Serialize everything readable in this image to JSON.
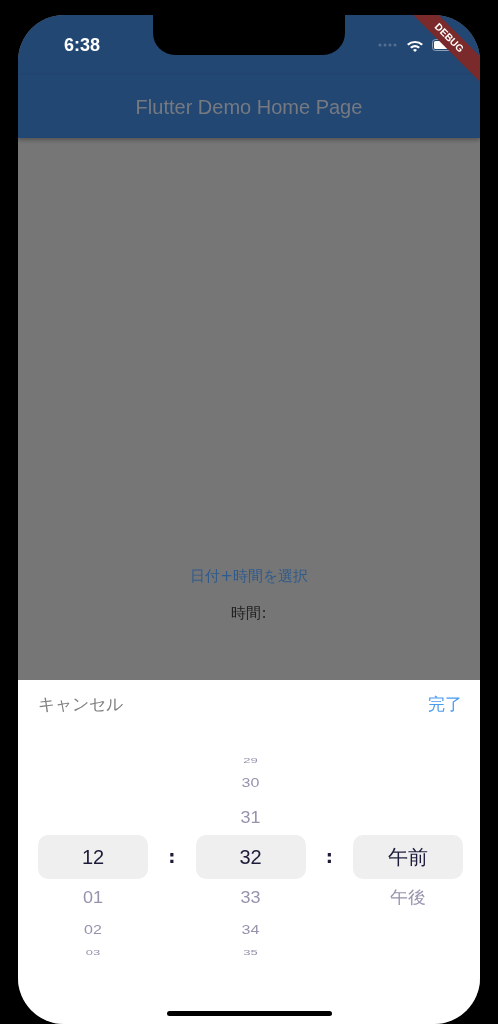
{
  "status_bar": {
    "time": "6:38"
  },
  "debug_banner": {
    "label": "DEBUG"
  },
  "app_bar": {
    "title": "Flutter Demo Home Page"
  },
  "body": {
    "link": "日付+時間を選択",
    "time_label": "時間:"
  },
  "picker": {
    "cancel": "キャンセル",
    "done": "完了",
    "columns": [
      {
        "items": [
          {
            "label": "12",
            "selected": true
          },
          {
            "label": "01",
            "selected": false
          },
          {
            "label": "02",
            "selected": false
          },
          {
            "label": "03",
            "selected": false
          }
        ]
      },
      {
        "items": [
          {
            "label": "29",
            "selected": false
          },
          {
            "label": "30",
            "selected": false
          },
          {
            "label": "31",
            "selected": false
          },
          {
            "label": "32",
            "selected": true
          },
          {
            "label": "33",
            "selected": false
          },
          {
            "label": "34",
            "selected": false
          },
          {
            "label": "35",
            "selected": false
          }
        ]
      },
      {
        "items": [
          {
            "label": "午前",
            "selected": true
          },
          {
            "label": "午後",
            "selected": false
          }
        ]
      }
    ],
    "separators": [
      ":",
      ":"
    ]
  }
}
